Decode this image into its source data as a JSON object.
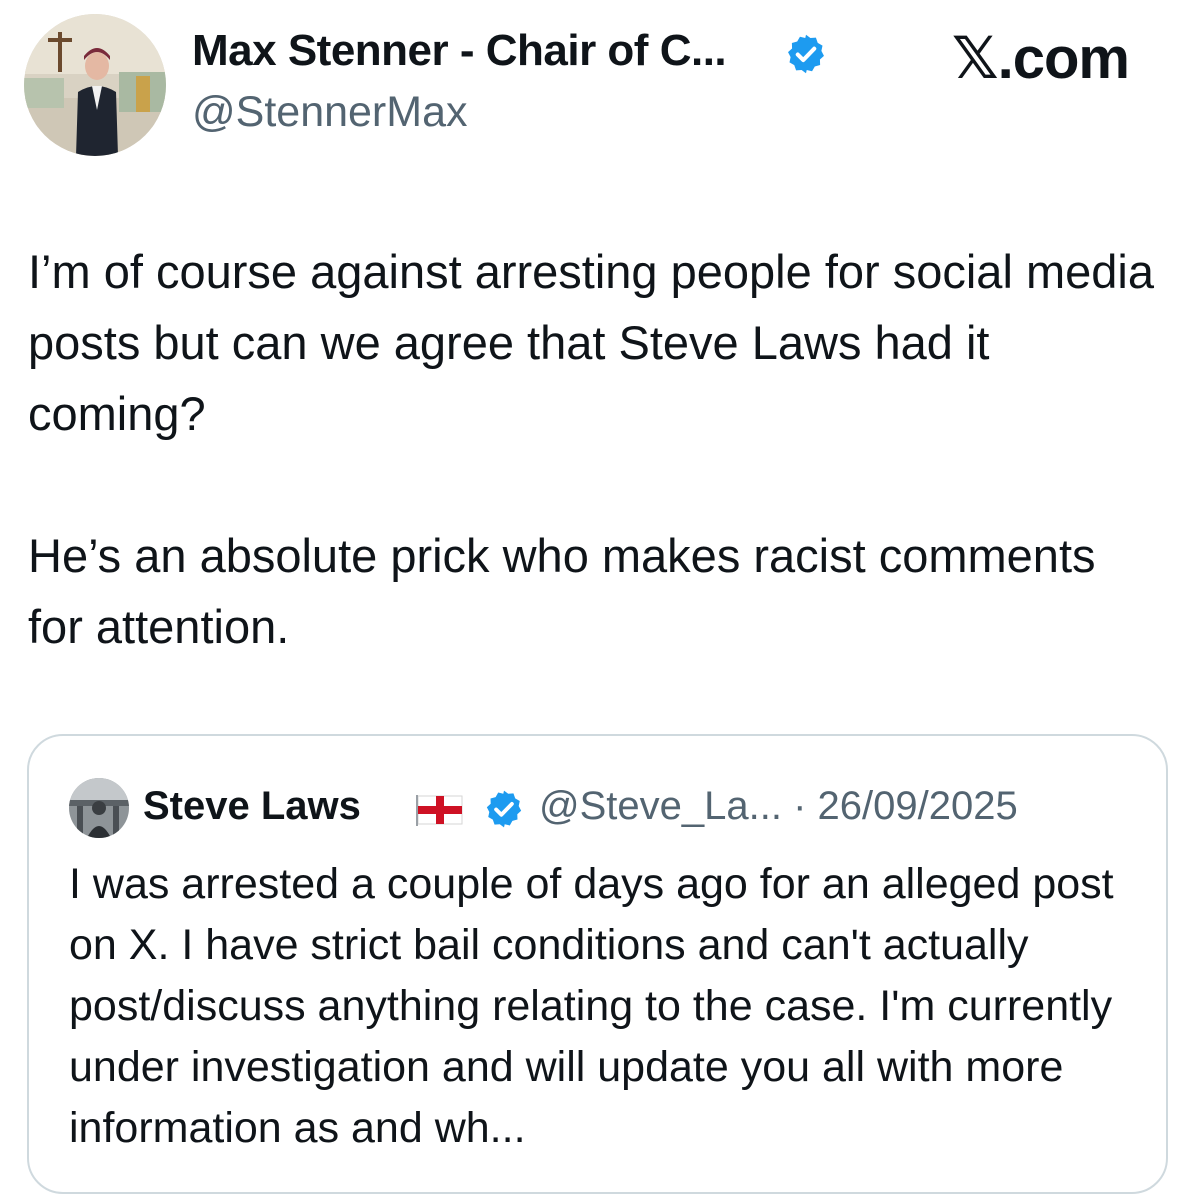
{
  "header": {
    "display_name": "Max Stenner - Chair of C...",
    "handle": "@StennerMax",
    "site_mark": "𝕏.com",
    "verified": true,
    "verified_color": "#1d9bf0"
  },
  "tweet": {
    "paragraphs": [
      "I’m of course against arresting people for social media posts but can we agree that Steve Laws had it coming?",
      "He’s an absolute prick who makes racist comments for attention."
    ]
  },
  "quote": {
    "name": "Steve Laws",
    "flag": "england-flag-icon",
    "verified": true,
    "handle": "@Steve_La...",
    "separator": " · ",
    "date": "26/09/2025",
    "text": "I was arrested a couple of days ago for an alleged post on X. I have strict bail conditions and can't actually post/discuss anything relating to the case. I'm currently under investigation and will update you all with more information as and wh..."
  },
  "colors": {
    "text_primary": "#0f1419",
    "text_secondary": "#536471",
    "border": "#cfd9de",
    "flag_red": "#ce1124"
  }
}
